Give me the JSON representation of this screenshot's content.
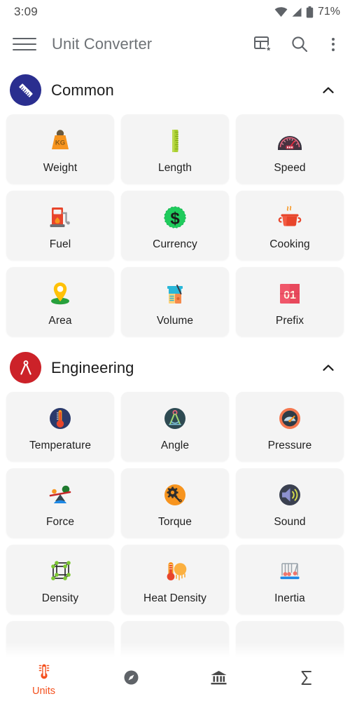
{
  "status_bar": {
    "clock": "3:09",
    "battery_percent": "71%",
    "icons": [
      "wifi-icon",
      "signal-icon",
      "battery-icon"
    ]
  },
  "app_bar": {
    "menu_icon": "hamburger-menu-icon",
    "title": "Unit Converter",
    "actions": [
      {
        "name": "favorites-table-icon",
        "label": "Favorites"
      },
      {
        "name": "search-icon",
        "label": "Search"
      },
      {
        "name": "overflow-menu-icon",
        "label": "More options"
      }
    ]
  },
  "sections": [
    {
      "id": "common",
      "title": "Common",
      "badge_icon": "ruler-icon",
      "badge_color": "#2A2E8F",
      "expanded": true,
      "collapse_icon": "chevron-up-icon",
      "items": [
        {
          "label": "Weight",
          "icon": "weight-kg-icon"
        },
        {
          "label": "Length",
          "icon": "ruler-length-icon"
        },
        {
          "label": "Speed",
          "icon": "speedometer-icon"
        },
        {
          "label": "Fuel",
          "icon": "fuel-pump-icon"
        },
        {
          "label": "Currency",
          "icon": "dollar-coin-icon"
        },
        {
          "label": "Cooking",
          "icon": "cooking-pot-icon"
        },
        {
          "label": "Area",
          "icon": "map-pin-icon"
        },
        {
          "label": "Volume",
          "icon": "beaker-icon"
        },
        {
          "label": "Prefix",
          "icon": "flip-counter-01-icon"
        }
      ]
    },
    {
      "id": "engineering",
      "title": "Engineering",
      "badge_icon": "compass-divider-icon",
      "badge_color": "#CC2229",
      "expanded": true,
      "collapse_icon": "chevron-up-icon",
      "items": [
        {
          "label": "Temperature",
          "icon": "thermometer-icon"
        },
        {
          "label": "Angle",
          "icon": "protractor-compass-icon"
        },
        {
          "label": "Pressure",
          "icon": "pressure-gauge-icon"
        },
        {
          "label": "Force",
          "icon": "seesaw-balance-icon"
        },
        {
          "label": "Torque",
          "icon": "wrench-gear-icon"
        },
        {
          "label": "Sound",
          "icon": "speaker-volume-icon"
        },
        {
          "label": "Density",
          "icon": "molecule-cube-icon"
        },
        {
          "label": "Heat Density",
          "icon": "thermometer-sun-icon"
        },
        {
          "label": "Inertia",
          "icon": "newtons-cradle-icon"
        }
      ]
    }
  ],
  "bottom_nav": {
    "active_color": "#F4511E",
    "inactive_color": "#5f6368",
    "items": [
      {
        "label": "Units",
        "icon": "thermometer-units-icon",
        "active": true
      },
      {
        "label": "",
        "icon": "compass-icon",
        "active": false
      },
      {
        "label": "",
        "icon": "bank-currency-icon",
        "active": false
      },
      {
        "label": "",
        "icon": "sigma-math-icon",
        "active": false
      }
    ]
  }
}
